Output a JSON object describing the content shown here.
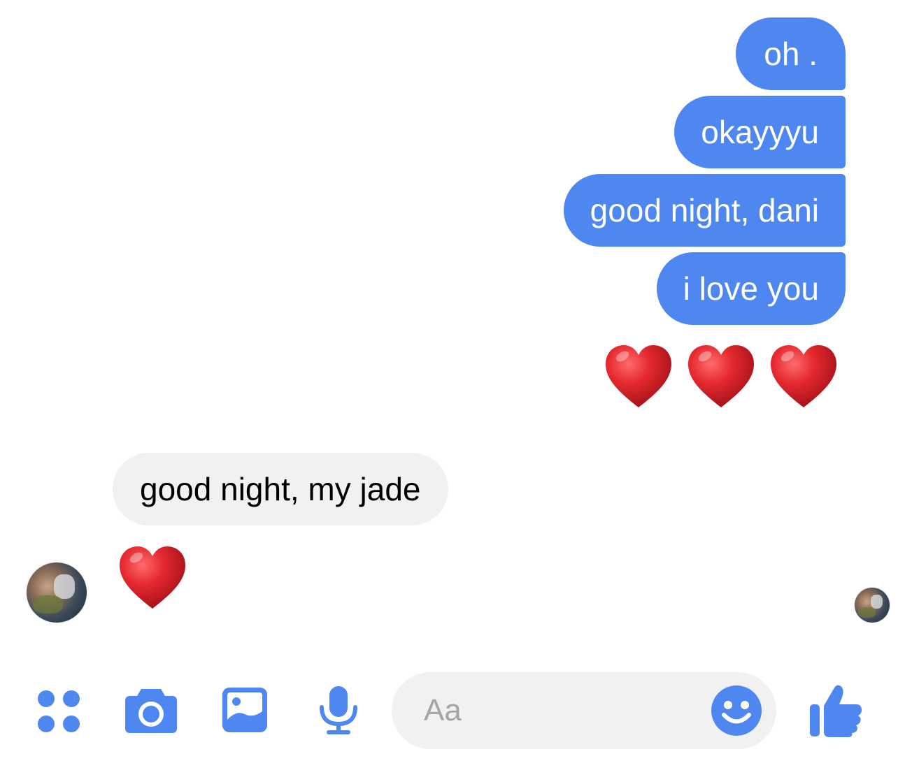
{
  "thread": {
    "outgoing": [
      {
        "text": "oh ."
      },
      {
        "text": "okayyyu"
      },
      {
        "text": "good night, dani"
      },
      {
        "text": "i love you"
      }
    ],
    "outgoing_reaction": "❤️❤️❤️",
    "incoming": [
      {
        "text": "good night, my jade"
      }
    ],
    "incoming_reaction": "❤️"
  },
  "composer": {
    "placeholder": "Aa"
  },
  "toolbar": {
    "icons": [
      "apps-icon",
      "camera-icon",
      "gallery-icon",
      "microphone-icon",
      "emoji-icon",
      "thumbs-up-icon"
    ]
  },
  "colors": {
    "accent": "#4E87EF",
    "outgoing_bubble": "#4E87EF",
    "incoming_bubble": "#F1F1F1",
    "heart": "#E0242B",
    "placeholder_text": "#A5A5A5"
  }
}
